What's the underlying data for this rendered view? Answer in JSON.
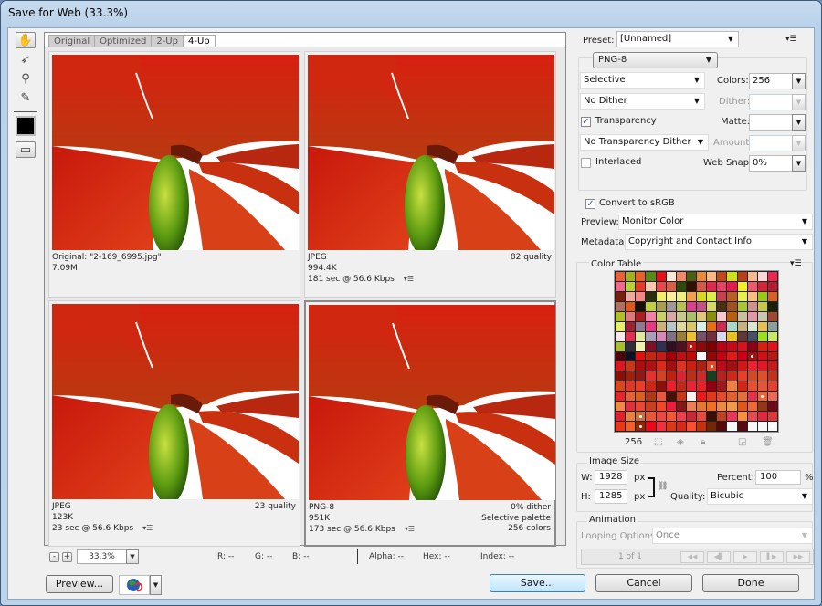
{
  "window": {
    "title": "Save for Web (33.3%)"
  },
  "tools": [
    {
      "name": "hand-tool",
      "glyph": "✋",
      "selected": true
    },
    {
      "name": "slice-select-tool",
      "glyph": "➶",
      "selected": false
    },
    {
      "name": "zoom-tool",
      "glyph": "🔍",
      "selected": false
    },
    {
      "name": "eyedropper-tool",
      "glyph": "✎",
      "selected": false
    }
  ],
  "eyedropper_color": "#000000",
  "view_tabs": [
    {
      "label": "Original",
      "active": false
    },
    {
      "label": "Optimized",
      "active": false
    },
    {
      "label": "2-Up",
      "active": false
    },
    {
      "label": "4-Up",
      "active": true
    }
  ],
  "panes": [
    {
      "line1_left": "Original: \"2-169_6995.jpg\"",
      "line2_left": "7.09M",
      "line3_left": "",
      "r1": "",
      "r2": "",
      "r3": "",
      "menu": false
    },
    {
      "line1_left": "JPEG",
      "line2_left": "994.4K",
      "line3_left": "181 sec @ 56.6 Kbps",
      "r1": "82 quality",
      "r2": "",
      "r3": "",
      "menu": true
    },
    {
      "line1_left": "JPEG",
      "line2_left": "123K",
      "line3_left": "23 sec @ 56.6 Kbps",
      "r1": "23 quality",
      "r2": "",
      "r3": "",
      "menu": true
    },
    {
      "line1_left": "PNG-8",
      "line2_left": "951K",
      "line3_left": "173 sec @ 56.6 Kbps",
      "r1": "0% dither",
      "r2": "Selective palette",
      "r3": "256 colors",
      "menu": true
    }
  ],
  "zoom": {
    "value": "33.3%",
    "minus": "-",
    "plus": "+"
  },
  "readouts": {
    "r": "R: --",
    "g": "G: --",
    "b": "B: --",
    "alpha": "Alpha: --",
    "hex": "Hex: --",
    "index": "Index: --"
  },
  "buttons": {
    "preview": "Preview...",
    "save": "Save...",
    "cancel": "Cancel",
    "done": "Done"
  },
  "settings": {
    "preset_label": "Preset:",
    "preset_value": "[Unnamed]",
    "format": "PNG-8",
    "reduction": "Selective",
    "colors_label": "Colors:",
    "colors_value": "256",
    "dither_algo": "No Dither",
    "dither_label": "Dither:",
    "transparency_label": "Transparency",
    "transparency_checked": true,
    "matte_label": "Matte:",
    "trans_dither": "No Transparency Dither",
    "amount_label": "Amount:",
    "interlaced_label": "Interlaced",
    "interlaced_checked": false,
    "websnap_label": "Web Snap:",
    "websnap_value": "0%",
    "convert_label": "Convert to sRGB",
    "convert_checked": true,
    "preview_label": "Preview:",
    "preview_value": "Monitor Color",
    "metadata_label": "Metadata:",
    "metadata_value": "Copyright and Contact Info"
  },
  "color_table": {
    "title": "Color Table",
    "count": "256",
    "colors": [
      "#e8603c",
      "#a8b020",
      "#e8602a",
      "#5a8a18",
      "#e8101a",
      "#fae8d8",
      "#f08a68",
      "#4a6010",
      "#e88a38",
      "#f8b888",
      "#c04818",
      "#d0e020",
      "#b84018",
      "#f8b890",
      "#f8d8d8",
      "#e82850",
      "#f06890",
      "#b8d030",
      "#e83a28",
      "#f8c8b0",
      "#e84848",
      "#d86048",
      "#304808",
      "#301008",
      "#d85848",
      "#e02850",
      "#e84060",
      "#e81850",
      "#f0f020",
      "#f05870",
      "#d02838",
      "#b81830",
      "#782010",
      "#f0a8a0",
      "#f08888",
      "#283010",
      "#f0f068",
      "#f8f0a0",
      "#f0f080",
      "#f0a050",
      "#d8d820",
      "#d8f048",
      "#c84050",
      "#b86028",
      "#e8f050",
      "#f8c080",
      "#98c818",
      "#d86020",
      "#b07060",
      "#e05818",
      "#181008",
      "#c0d040",
      "#a8a050",
      "#a09898",
      "#b8c050",
      "#d84090",
      "#c85088",
      "#d8d868",
      "#483010",
      "#a05020",
      "#a8c830",
      "#d09090",
      "#c8c848",
      "#182008",
      "#b0c028",
      "#e07878",
      "#a82020",
      "#f080a8",
      "#c8d068",
      "#d8a8a8",
      "#c8c890",
      "#a8c068",
      "#e0c878",
      "#889010",
      "#f8c8d0",
      "#b86010",
      "#c8c0a0",
      "#e098a8",
      "#c8c8b0",
      "#a04830",
      "#e8f068",
      "#a02030",
      "#907890",
      "#e83880",
      "#d0b078",
      "#b8c8c8",
      "#e0d8a0",
      "#d8c868",
      "#d8f0e8",
      "#e87010",
      "#d02850",
      "#a8d8c8",
      "#c8b080",
      "#d8e8d0",
      "#e8c050",
      "#88a0a0",
      "#f8e8f0",
      "#e03050",
      "#e0e8a0",
      "#a8a0b8",
      "#d888b8",
      "#807080",
      "#988038",
      "#f0c030",
      "#785068",
      "#703040",
      "#d8d8f0",
      "#e8c020",
      "#603838",
      "#485068",
      "#98e020",
      "#c8e860",
      "#a8c030",
      "#303038",
      "#f0f0b0",
      "#801028",
      "#303050",
      "#301020",
      "#501020",
      "#c81010",
      "#900808",
      "#800000",
      "#c00010",
      "#c80818",
      "#d81020",
      "#900010",
      "#d82010",
      "#e81018",
      "#500008",
      "#101020",
      "#e01010",
      "#c02810",
      "#c81818",
      "#a00008",
      "#c01010",
      "#b81008",
      "#f8f8f8",
      "#900808",
      "#c80010",
      "#e01818",
      "#c80018",
      "#a81010",
      "#d01018",
      "#b81810",
      "#d81820",
      "#c83818",
      "#a81010",
      "#b01018",
      "#e02818",
      "#a01010",
      "#e03020",
      "#c82010",
      "#b02010",
      "#e04828",
      "#c00818",
      "#a01010",
      "#d01818",
      "#f02030",
      "#e01828",
      "#c81818",
      "#881008",
      "#a02010",
      "#901818",
      "#e83030",
      "#d84020",
      "#c02010",
      "#e02030",
      "#b83018",
      "#d02828",
      "#184020",
      "#b82020",
      "#d02818",
      "#e84028",
      "#d84820",
      "#e05028",
      "#c83018",
      "#d84820",
      "#e03828",
      "#e84028",
      "#c82818",
      "#901008",
      "#e82030",
      "#c02818",
      "#e02838",
      "#e82028",
      "#900010",
      "#a01818",
      "#f08040",
      "#d02818",
      "#e85030",
      "#e05838",
      "#e84030",
      "#e02828",
      "#e86038",
      "#d86020",
      "#b03818",
      "#e85840",
      "#481008",
      "#c83818",
      "#f8f0f0",
      "#f01818",
      "#e03818",
      "#e84828",
      "#e06030",
      "#e07040",
      "#e83048",
      "#e86838",
      "#f06858",
      "#f08848",
      "#e03040",
      "#e84838",
      "#c84020",
      "#f04828",
      "#e82040",
      "#881818",
      "#e88058",
      "#e87830",
      "#f07028",
      "#f08840",
      "#f09850",
      "#e05818",
      "#f06838",
      "#903818",
      "#700818",
      "#e02030",
      "#e88040",
      "#c87040",
      "#e85838",
      "#f04840",
      "#f05838",
      "#f04050",
      "#c82838",
      "#e84840",
      "#381008",
      "#c04020",
      "#e83858",
      "#f89040",
      "#e84850",
      "#e02840",
      "#e03838",
      "#e83818",
      "#f06028",
      "#902808",
      "#e80818",
      "#f03040",
      "#d83818",
      "#d82818",
      "#f85030",
      "#c83010",
      "#702808",
      "#580808",
      "#f8f8f8",
      "#580810",
      "#f8f8f8",
      "#f8f8f8",
      "#f8f8f8"
    ],
    "marked_indices": [
      119,
      141,
      153,
      206,
      226,
      242,
      255
    ]
  },
  "image_size": {
    "title": "Image Size",
    "w_label": "W:",
    "w_value": "1928",
    "w_unit": "px",
    "h_label": "H:",
    "h_value": "1285",
    "h_unit": "px",
    "percent_label": "Percent:",
    "percent_value": "100",
    "percent_unit": "%",
    "quality_label": "Quality:",
    "quality_value": "Bicubic"
  },
  "animation": {
    "title": "Animation",
    "looping_label": "Looping Options:",
    "looping_value": "Once",
    "frame": "1 of 1"
  }
}
